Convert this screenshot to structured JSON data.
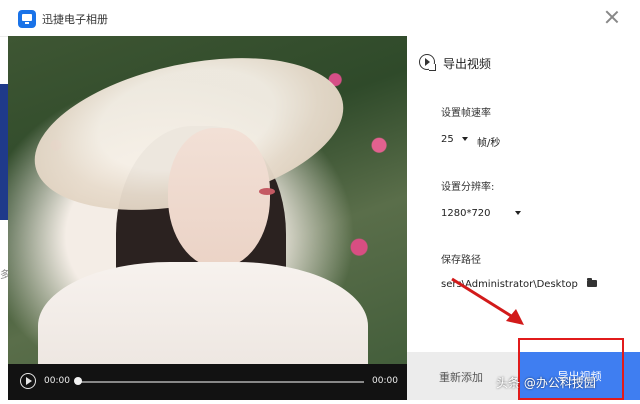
{
  "app": {
    "title": "迅捷电子相册"
  },
  "background": {
    "fragment_text": "多"
  },
  "video": {
    "time_current": "00:00",
    "time_total": "00:00"
  },
  "panel": {
    "title": "导出视频",
    "fps": {
      "label": "设置帧速率",
      "value": "25",
      "unit": "帧/秒"
    },
    "resolution": {
      "label": "设置分辨率:",
      "value": "1280*720"
    },
    "save_path": {
      "label": "保存路径",
      "value": "sers\\Administrator\\Desktop"
    },
    "buttons": {
      "readd": "重新添加",
      "export": "导出视频"
    }
  },
  "watermark": "头条 @办公科技园",
  "colors": {
    "accent": "#3f7ef1",
    "highlight_red": "#e11b1b"
  }
}
